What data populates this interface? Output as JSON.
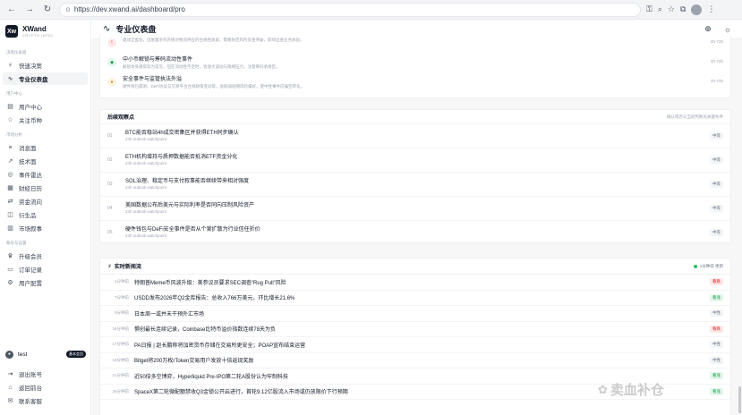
{
  "browser": {
    "url": "https://dev.xwand.ai/dashboard/pro"
  },
  "sidebar": {
    "brand": {
      "name": "XWand",
      "sub": "CRYPTO INTEL",
      "logo": "Xw"
    },
    "sections": [
      {
        "title": "决策仪表盘",
        "items": [
          {
            "label": "快速决策",
            "icon": "lightning-icon"
          },
          {
            "label": "专业仪表盘",
            "icon": "wave-icon",
            "active": true
          }
        ]
      },
      {
        "title": "用户中心",
        "items": [
          {
            "label": "用户中心",
            "icon": "doc-icon"
          },
          {
            "label": "关注币种",
            "icon": "star-icon"
          }
        ]
      },
      {
        "title": "市场分析",
        "items": [
          {
            "label": "消息面",
            "icon": "list-icon"
          },
          {
            "label": "技术面",
            "icon": "trend-icon"
          },
          {
            "label": "事件雷达",
            "icon": "radar-icon"
          },
          {
            "label": "财经日历",
            "icon": "calendar-icon"
          },
          {
            "label": "资金流向",
            "icon": "flow-icon"
          },
          {
            "label": "衍生品",
            "icon": "layers-icon"
          },
          {
            "label": "市场叙事",
            "icon": "book-icon"
          }
        ]
      },
      {
        "title": "账号与设置",
        "items": [
          {
            "label": "升级会员",
            "icon": "crown-icon"
          },
          {
            "label": "订单记录",
            "icon": "receipt-icon"
          },
          {
            "label": "用户配置",
            "icon": "settings-icon"
          }
        ]
      }
    ],
    "user": {
      "name": "test",
      "badge": "基本会员"
    },
    "bottom": [
      {
        "label": "退出账号",
        "icon": "logout-icon"
      },
      {
        "label": "返回前台",
        "icon": "home-icon"
      },
      {
        "label": "联系客服",
        "icon": "chat-icon"
      }
    ]
  },
  "topbar": {
    "title": "专业仪表盘"
  },
  "events": [
    {
      "title": "",
      "desc": "驱动全面化，出账量亲作开始对物流供应的合规性收紧，需要防范风险资金突破，影响出金业务体验。",
      "time": "2h-72h",
      "color": "#fde8e8",
      "tc": "#dc2626",
      "glyph": "!"
    },
    {
      "title": "中小币解锁与筹码流动性事件",
      "desc": "解锁本身通常较为常见，但在流动性不足时，会放大波动与情绪压力，注意筹码承接区。",
      "time": "2h-72h",
      "color": "#e5f6ec",
      "tc": "#16a34a",
      "glyph": "◆"
    },
    {
      "title": "安全事件与监管执法外溢",
      "desc": "硬件钱包漏洞、DeFi协议与交易平台合规政策变动等，会削弱短期风险偏好，使中性事件向偏空转化。",
      "time": "2h-72h",
      "color": "#fef3e2",
      "tc": "#d97706",
      "glyph": "●"
    }
  ],
  "watchpoints": {
    "title": "后续观察点",
    "note": "确认或否认当前判断的关键条件",
    "items": [
      {
        "num": "01",
        "title": "BTC能否稳站4h成交密集区并获得ETH同步确认",
        "sub": "24h outlook watchpoint",
        "tag": "中等"
      },
      {
        "num": "02",
        "title": "ETH机构增持与质押数据能否抵消ETF资金分化",
        "sub": "24h outlook watchpoint",
        "tag": "中等"
      },
      {
        "num": "03",
        "title": "SOL治理、稳定币与支付叙事能否继续带来相对强度",
        "sub": "24h outlook watchpoint",
        "tag": "中等"
      },
      {
        "num": "04",
        "title": "美国数据公布后美元与实际利率是否同向压制风险资产",
        "sub": "24h outlook watchpoint",
        "tag": "中等"
      },
      {
        "num": "05",
        "title": "硬件钱包与DeFi安全事件是否从个案扩散为行业信任折价",
        "sub": "24h outlook watchpoint",
        "tag": "中等"
      }
    ]
  },
  "newsfeed": {
    "title": "实时新闻流",
    "status": "1分钟前 更新",
    "items": [
      {
        "time": "1分钟前",
        "title": "特朗普Meme币风波升级：美参议员要求SEC调查“Rug Pull”风险",
        "tag": "看跌",
        "kind": "bear"
      },
      {
        "time": "7分钟前",
        "title": "USDD发布2026年Q2金库报告：总收入766万美元，环比增长21.6%",
        "tag": "看涨",
        "kind": "bull"
      },
      {
        "time": "9分钟前",
        "title": "日本周一或并未干预外汇市场",
        "tag": "中性",
        "kind": "neutral"
      },
      {
        "time": "18分钟前",
        "title": "惧创最长连续记录，Coinbase比特币溢价指数连续78天为负",
        "tag": "看跌",
        "kind": "bear"
      },
      {
        "time": "17分钟前",
        "title": "PA日报 | 赵长鹏称将加密货币存储在交易所更安全；POAP宣布结束运营",
        "tag": "中性",
        "kind": "neutral"
      },
      {
        "time": "18分钟前",
        "title": "Bitget将200万枚rToken交易用户发放十倍返现奖励",
        "tag": "中性",
        "kind": "neutral"
      },
      {
        "time": "21分钟前",
        "title": "近50倍多空博弈，Hyperliquid Pre-IPO第二轮A股份认为牢制科技",
        "tag": "看涨",
        "kind": "bull"
      },
      {
        "time": "26分钟前",
        "title": "SpaceX第二轮微配额禁收Q3金锁公开启进行，首轮9.12亿股流入市场或仍放限价下行预期",
        "tag": "看涨",
        "kind": "bull"
      }
    ]
  },
  "watermark": "卖血补仓"
}
